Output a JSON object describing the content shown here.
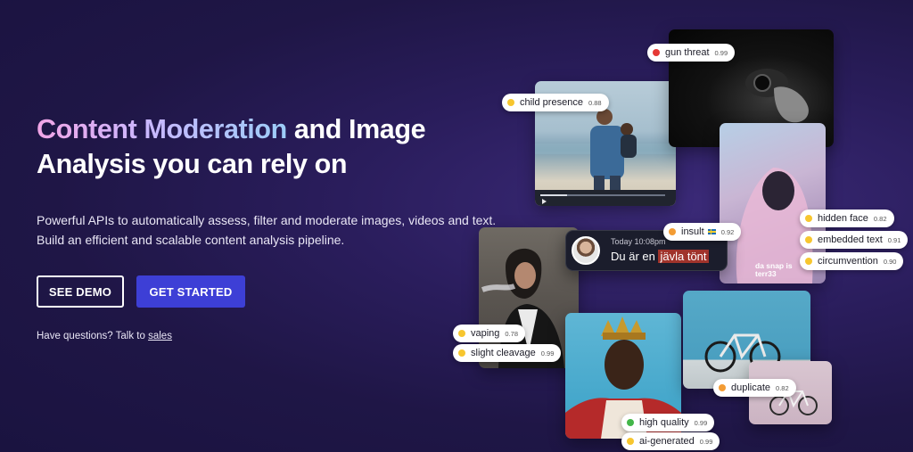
{
  "hero": {
    "headline_accent": "Content Moderation",
    "headline_line1_rest": " and Image",
    "headline_line2": "Analysis you can rely on",
    "subtitle": "Powerful APIs to automatically assess, filter and moderate images, videos and text. Build an efficient and scalable content analysis pipeline.",
    "see_demo_label": "SEE DEMO",
    "get_started_label": "GET STARTED",
    "questions_prefix": "Have questions? Talk to ",
    "sales_link": "sales"
  },
  "chat": {
    "time": "Today 10:08pm",
    "message_prefix": "Du är en ",
    "message_flagged": "jävla tönt"
  },
  "graffiti_text": "da snap is terr33",
  "tags": {
    "gun_threat": {
      "label": "gun threat",
      "score": "0.99",
      "color": "#e53935"
    },
    "child_presence": {
      "label": "child presence",
      "score": "0.88",
      "color": "#f7c62f"
    },
    "hidden_face": {
      "label": "hidden face",
      "score": "0.82",
      "color": "#f7c62f"
    },
    "embedded_text": {
      "label": "embedded text",
      "score": "0.91",
      "color": "#f7c62f"
    },
    "circumvention": {
      "label": "circumvention",
      "score": "0.90",
      "color": "#f7c62f"
    },
    "insult": {
      "label": "insult",
      "score": "0.92",
      "color": "#f39c34"
    },
    "vaping": {
      "label": "vaping",
      "score": "0.78",
      "color": "#f7c62f"
    },
    "slight_cleavage": {
      "label": "slight cleavage",
      "score": "0.99",
      "color": "#f7c62f"
    },
    "duplicate": {
      "label": "duplicate",
      "score": "0.82",
      "color": "#f39c34"
    },
    "high_quality": {
      "label": "high quality",
      "score": "0.99",
      "color": "#43b649"
    },
    "ai_generated": {
      "label": "ai-generated",
      "score": "0.99",
      "color": "#f7c62f"
    }
  }
}
